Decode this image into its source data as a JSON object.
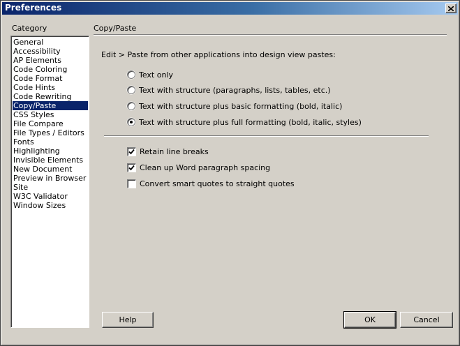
{
  "window": {
    "title": "Preferences"
  },
  "category": {
    "label": "Category",
    "selected": "Copy/Paste",
    "items": [
      "General",
      "Accessibility",
      "AP Elements",
      "Code Coloring",
      "Code Format",
      "Code Hints",
      "Code Rewriting",
      "Copy/Paste",
      "CSS Styles",
      "File Compare",
      "File Types / Editors",
      "Fonts",
      "Highlighting",
      "Invisible Elements",
      "New Document",
      "Preview in Browser",
      "Site",
      "W3C Validator",
      "Window Sizes"
    ]
  },
  "panel": {
    "title": "Copy/Paste",
    "intro": "Edit > Paste from other applications into design view pastes:",
    "radios": [
      {
        "label": "Text only",
        "checked": false
      },
      {
        "label": "Text with structure (paragraphs, lists, tables, etc.)",
        "checked": false
      },
      {
        "label": "Text with structure plus basic formatting (bold, italic)",
        "checked": false
      },
      {
        "label": "Text with structure plus full formatting (bold, italic, styles)",
        "checked": true
      }
    ],
    "checkboxes": [
      {
        "label": "Retain line breaks",
        "checked": true
      },
      {
        "label": "Clean up Word paragraph spacing",
        "checked": true
      },
      {
        "label": "Convert smart quotes to straight quotes",
        "checked": false
      }
    ]
  },
  "buttons": {
    "help": "Help",
    "ok": "OK",
    "cancel": "Cancel"
  }
}
